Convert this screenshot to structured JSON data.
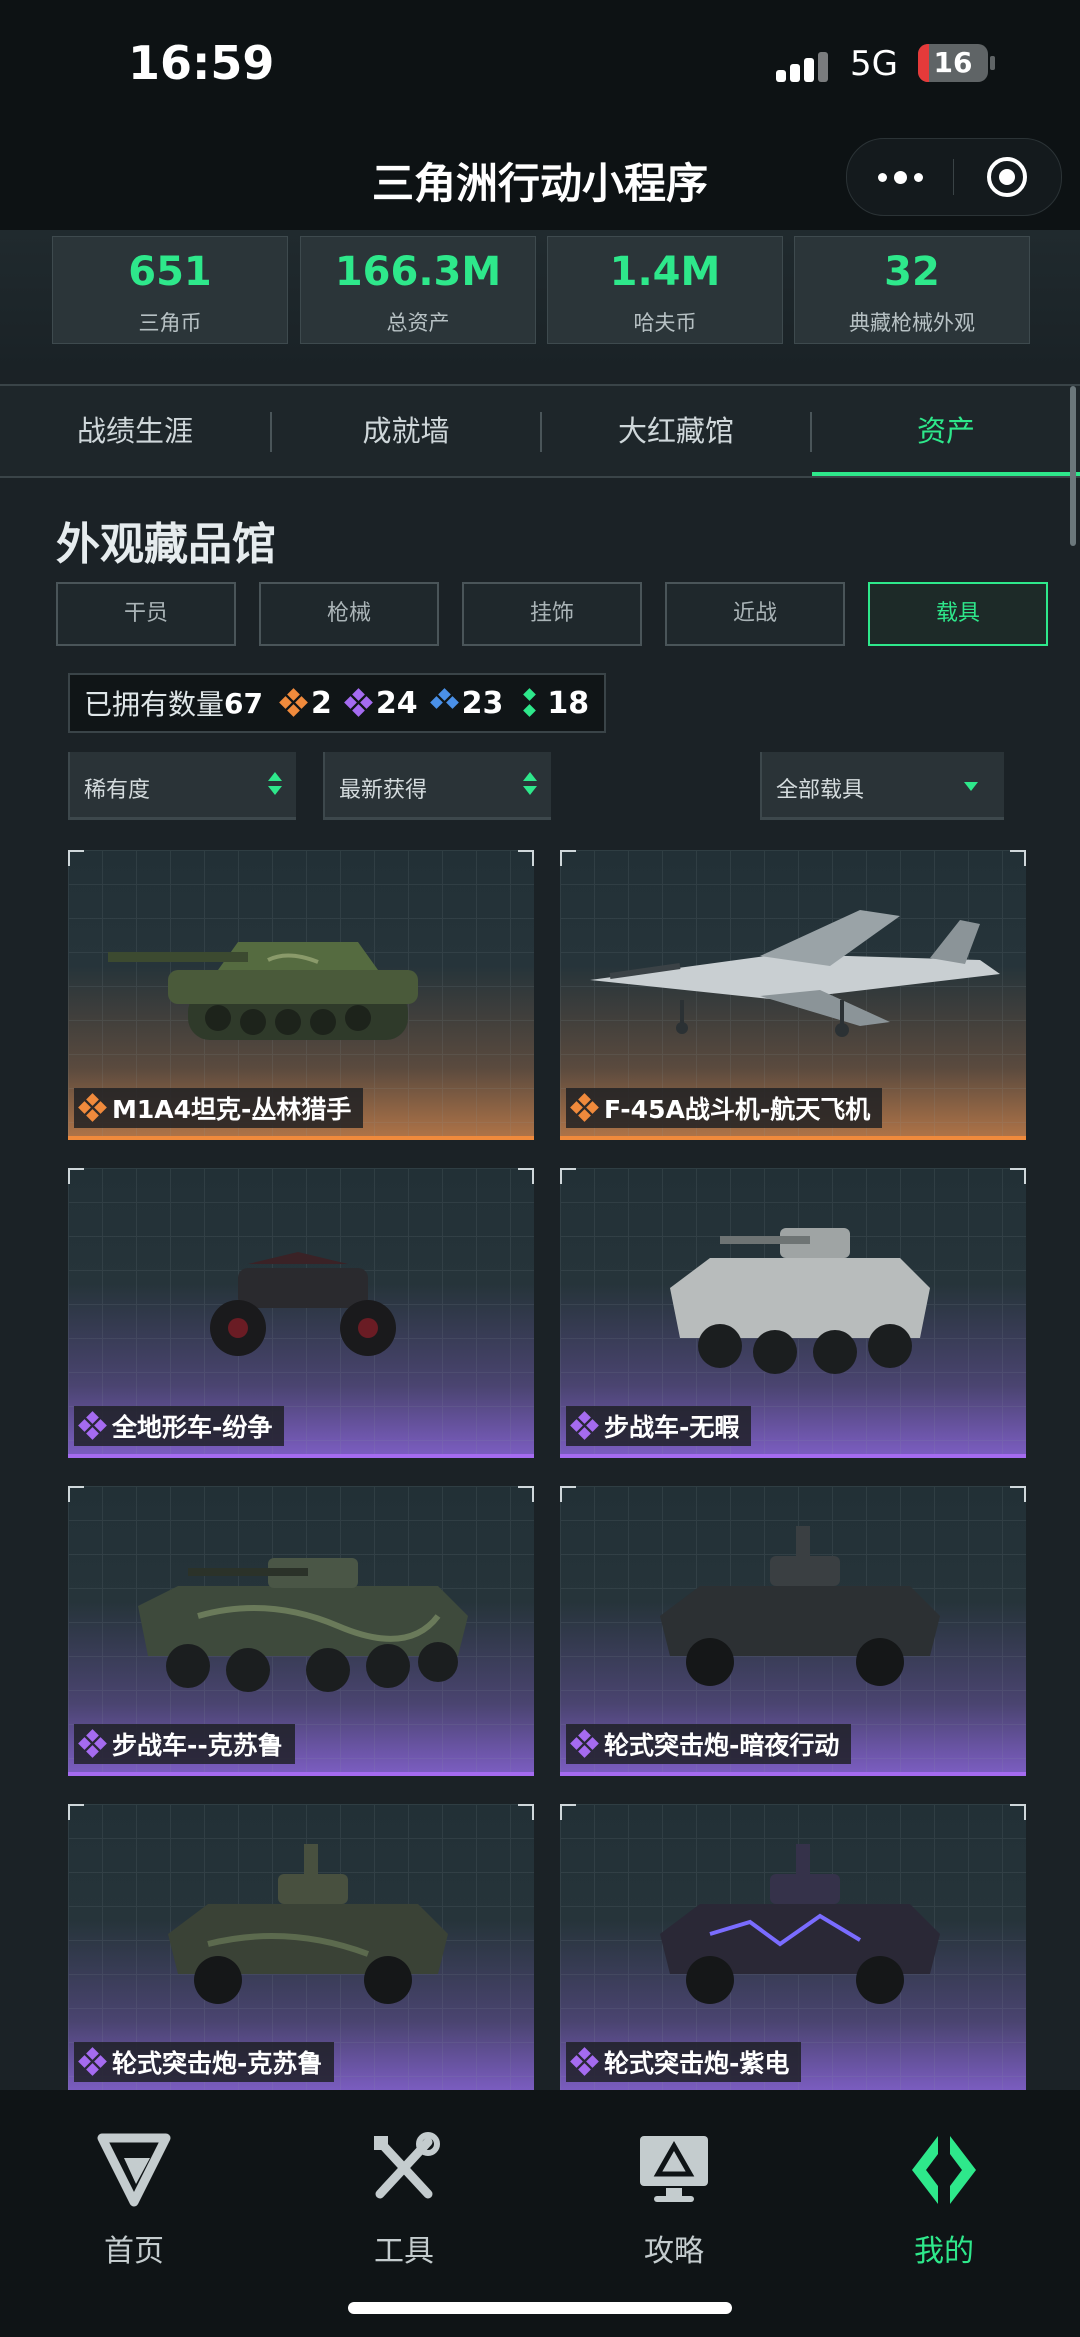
{
  "status": {
    "time": "16:59",
    "network": "5G",
    "battery": "16",
    "battery_level": 0.16
  },
  "nav": {
    "title": "三角洲行动小程序"
  },
  "stats": [
    {
      "value": "651",
      "label": "三角币"
    },
    {
      "value": "166.3M",
      "label": "总资产"
    },
    {
      "value": "1.4M",
      "label": "哈夫币"
    },
    {
      "value": "32",
      "label": "典藏枪械外观"
    }
  ],
  "tabs": [
    {
      "label": "战绩生涯",
      "active": false
    },
    {
      "label": "成就墙",
      "active": false
    },
    {
      "label": "大红藏馆",
      "active": false
    },
    {
      "label": "资产",
      "active": true
    }
  ],
  "section": {
    "title": "外观藏品馆"
  },
  "categories": [
    {
      "label": "干员",
      "active": false
    },
    {
      "label": "枪械",
      "active": false
    },
    {
      "label": "挂饰",
      "active": false
    },
    {
      "label": "近战",
      "active": false
    },
    {
      "label": "载具",
      "active": true
    }
  ],
  "owned": {
    "label": "已拥有数量",
    "total": "67",
    "rarity": [
      {
        "name": "orange",
        "color": "#f08a3c",
        "count": "2"
      },
      {
        "name": "purple",
        "color": "#a56bf0",
        "count": "24"
      },
      {
        "name": "blue",
        "color": "#4a90e8",
        "count": "23"
      },
      {
        "name": "green",
        "color": "#2ee88b",
        "count": "18"
      }
    ]
  },
  "filters": {
    "rarity": "稀有度",
    "sort": "最新获得",
    "type": "全部载具"
  },
  "colors": {
    "accent": "#2ee88b",
    "legendary": "#f08a3c",
    "epic": "#a56bf0"
  },
  "vehicles": [
    {
      "name": "M1A4坦克-丛林猎手",
      "rarity": "orange",
      "kind": "tank"
    },
    {
      "name": "F-45A战斗机-航天飞机",
      "rarity": "orange",
      "kind": "jet"
    },
    {
      "name": "全地形车-纷争",
      "rarity": "purple",
      "kind": "atv"
    },
    {
      "name": "步战车-无暇",
      "rarity": "purple",
      "kind": "ifv-white"
    },
    {
      "name": "步战车--克苏鲁",
      "rarity": "purple",
      "kind": "ifv-camo"
    },
    {
      "name": "轮式突击炮-暗夜行动",
      "rarity": "purple",
      "kind": "wheeled-dark"
    },
    {
      "name": "轮式突击炮-克苏鲁",
      "rarity": "purple",
      "kind": "wheeled-camo"
    },
    {
      "name": "轮式突击炮-紫电",
      "rarity": "purple",
      "kind": "wheeled-purple"
    }
  ],
  "tabbar": [
    {
      "label": "首页",
      "icon": "delta-logo-icon",
      "active": false
    },
    {
      "label": "工具",
      "icon": "tools-icon",
      "active": false
    },
    {
      "label": "攻略",
      "icon": "monitor-guide-icon",
      "active": false
    },
    {
      "label": "我的",
      "icon": "profile-diamond-icon",
      "active": true
    }
  ]
}
